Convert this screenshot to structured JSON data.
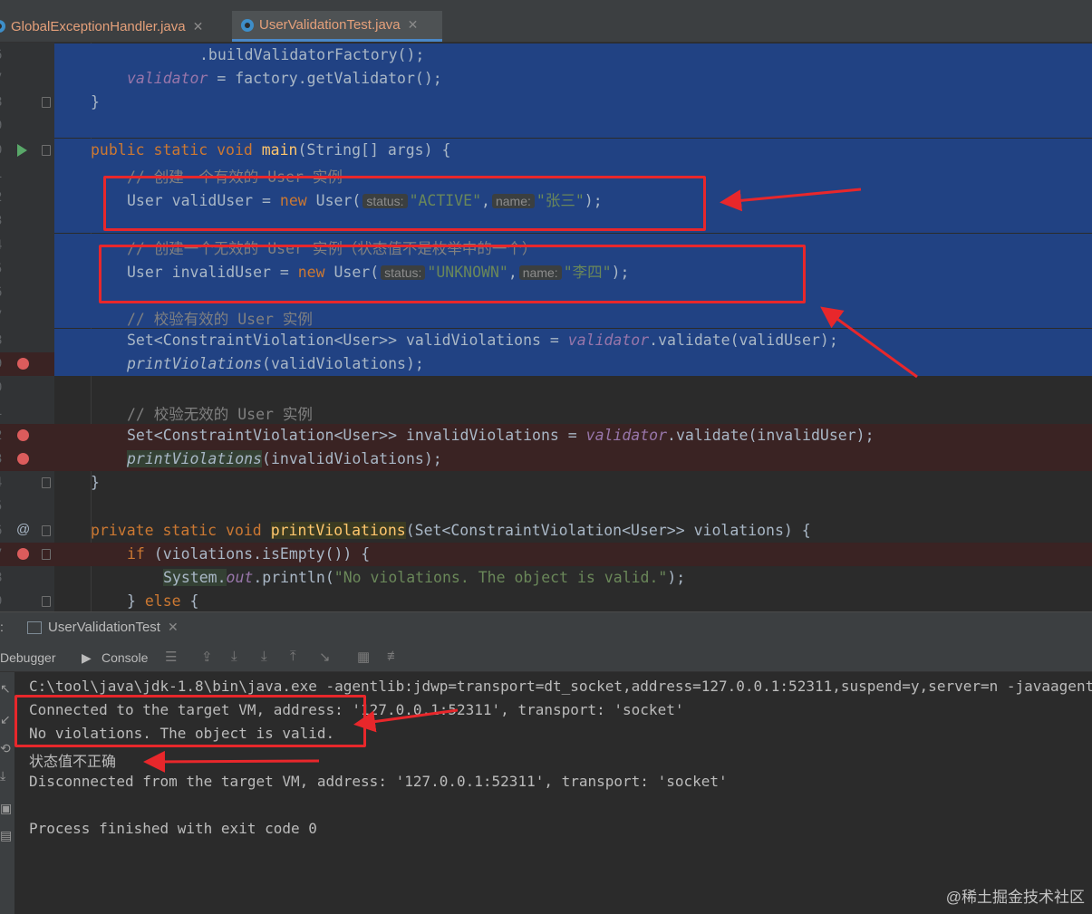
{
  "tabs": [
    {
      "name": "GlobalExceptionHandler.java"
    },
    {
      "name": "UserValidationTest.java"
    }
  ],
  "editor": {
    "line_numbers": [
      "6",
      "7",
      "8",
      "9",
      "0",
      "1",
      "2",
      "3",
      "4",
      "5",
      "6",
      "7",
      "8",
      "9",
      "0",
      "1",
      "2",
      "3",
      "4",
      "5",
      "6",
      "7",
      "8",
      "9"
    ],
    "lines": {
      "l0": ".buildValidatorFactory();",
      "l1a": "validator",
      "l1b": " = factory.getValidator();",
      "l2": "}",
      "l4a": "public static void ",
      "l4b": "main",
      "l4c": "(String[] args) {",
      "l5": "// 创建一个有效的 User 实例",
      "l6a": "User validUser = ",
      "l6b": "new",
      "l6c": " User(",
      "l6h1": "status:",
      "l6s1": "\"ACTIVE\"",
      "l6comma": ",",
      "l6h2": "name:",
      "l6s2": "\"张三\"",
      "l6end": ");",
      "l8": "// 创建一个无效的 User 实例（状态值不是枚举中的一个）",
      "l9a": "User invalidUser = ",
      "l9b": "new",
      "l9c": " User(",
      "l9h1": "status:",
      "l9s1": "\"UNKNOWN\"",
      "l9comma": ",",
      "l9h2": "name:",
      "l9s2": "\"李四\"",
      "l9end": ");",
      "l11": "// 校验有效的 User 实例",
      "l12a": "Set<ConstraintViolation<User>> validViolations = ",
      "l12b": "validator",
      "l12c": ".validate(validUser);",
      "l13a": "printViolations",
      "l13b": "(validViolations);",
      "l15": "// 校验无效的 User 实例",
      "l16a": "Set<ConstraintViolation<User>> invalidViolations = ",
      "l16b": "validator",
      "l16c": ".validate(invalidUser);",
      "l17a": "printViolations",
      "l17b": "(invalidViolations);",
      "l18": "}",
      "l20a": "private static void ",
      "l20b": "printViolations",
      "l20c": "(Set<ConstraintViolation<User>> violations) {",
      "l21a": "if",
      "l21b": " (violations.isEmpty()) {",
      "l22a": "System.",
      "l22b": "out",
      "l22c": ".println(",
      "l22d": "\"No violations. The object is valid.\"",
      "l22e": ");",
      "l23a": "} ",
      "l23b": "else",
      "l23c": " {"
    }
  },
  "run_panel": {
    "tab": "UserValidationTest",
    "debugger_label": "Debugger",
    "console_label": "Console"
  },
  "console": {
    "lines": [
      "C:\\tool\\java\\jdk-1.8\\bin\\java.exe -agentlib:jdwp=transport=dt_socket,address=127.0.0.1:52311,suspend=y,server=n -javaagent",
      "Connected to the target VM, address: '127.0.0.1:52311', transport: 'socket'",
      "No violations. The object is valid.",
      "状态值不正确",
      "Disconnected from the target VM, address: '127.0.0.1:52311', transport: 'socket'",
      "",
      "Process finished with exit code 0"
    ]
  },
  "watermark": "@稀土掘金技术社区",
  "colors": {
    "annotation_red": "#E8272B",
    "selection": "#214283",
    "breakpoint": "#DB5C5C"
  }
}
